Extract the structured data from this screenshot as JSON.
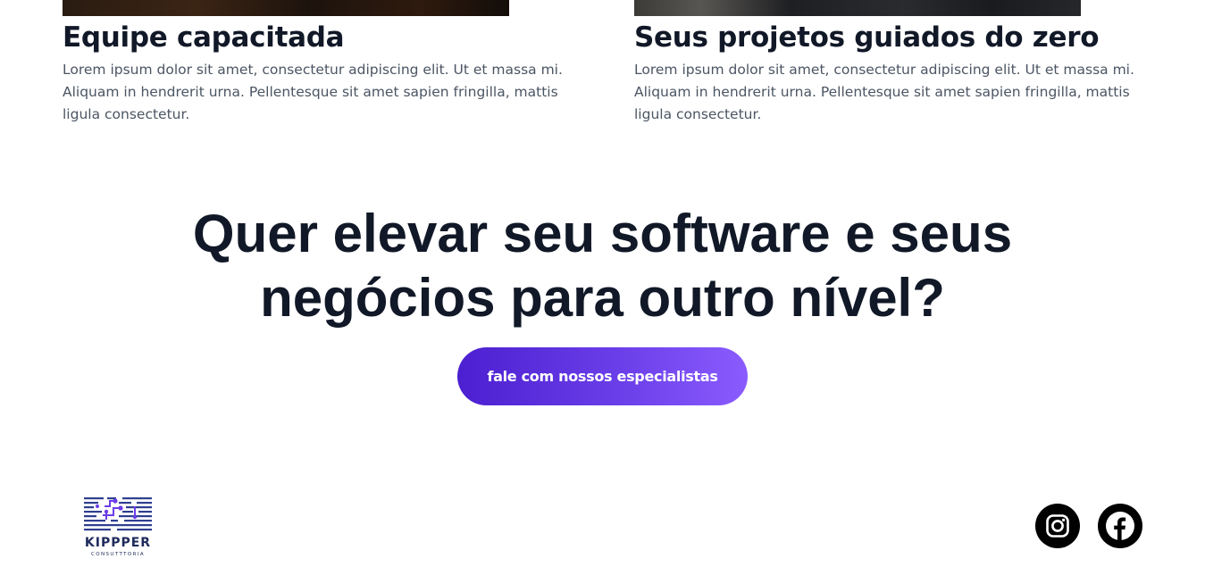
{
  "features": [
    {
      "title": "Equipe capacitada",
      "text": "Lorem ipsum dolor sit amet, consectetur adipiscing elit. Ut et massa mi. Aliquam in hendrerit urna. Pellentesque sit amet sapien fringilla, mattis ligula consectetur."
    },
    {
      "title": "Seus projetos guiados do zero",
      "text": "Lorem ipsum dolor sit amet, consectetur adipiscing elit. Ut et massa mi. Aliquam in hendrerit urna. Pellentesque sit amet sapien fringilla, mattis ligula consectetur."
    }
  ],
  "cta": {
    "heading_line1": "Quer elevar seu software e seus",
    "heading_line2": "negócios para outro nível?",
    "button_label": "fale com nossos especialistas"
  },
  "footer": {
    "logo_name": "KIPPPER",
    "logo_tagline": "CONSUTTTORIA",
    "social_icons": [
      "instagram-icon",
      "facebook-icon"
    ]
  },
  "colors": {
    "heading": "#111827",
    "body_text": "#4b5563",
    "button_gradient_start": "#4c1fd0",
    "button_gradient_end": "#8a5cff",
    "logo": "#1e2a5a",
    "social_bg": "#000000"
  }
}
